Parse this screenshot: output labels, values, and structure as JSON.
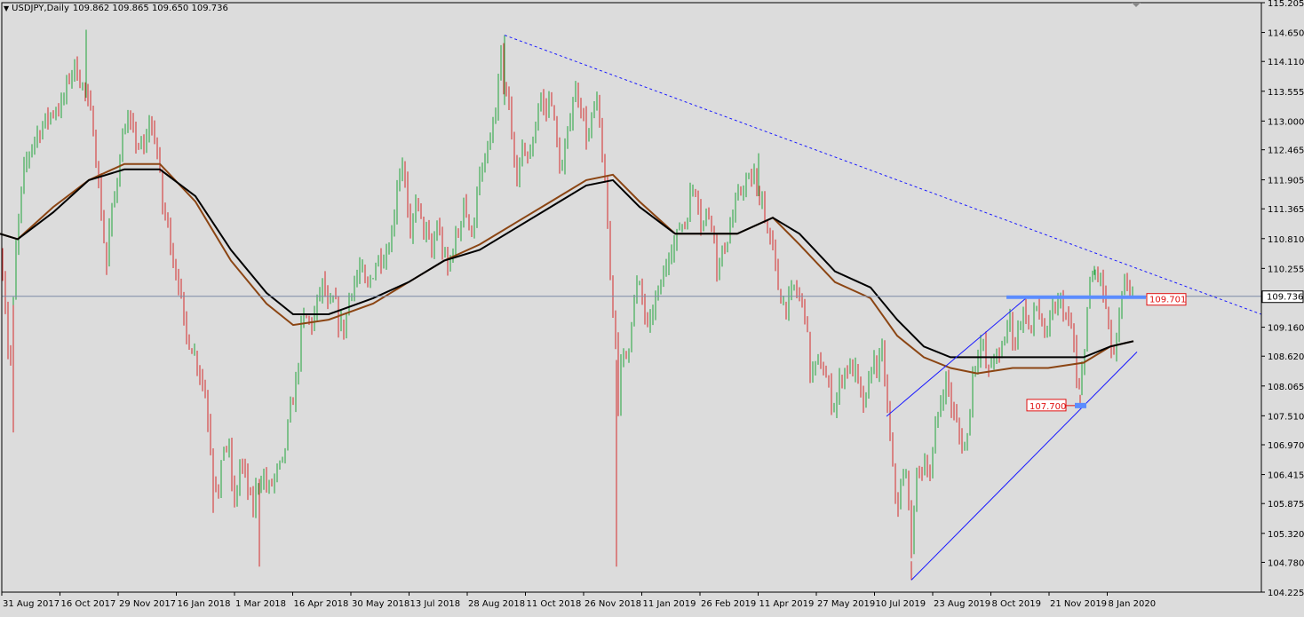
{
  "header": {
    "symbol": "USDJPY,Daily",
    "ohlc": "109.862 109.865 109.650 109.736",
    "menu_icon": "triangle-down-icon"
  },
  "colors": {
    "background": "#dcdcdc",
    "bull": "#1fa33a",
    "bear": "#d42a2a",
    "ma_fast": "#000000",
    "ma_slow": "#8b4513",
    "trendline": "#1a1aff",
    "resistance": "#5b8cff",
    "price_line": "#7c8aa6",
    "label_red": "#e01010"
  },
  "chart_data": {
    "type": "candlestick",
    "symbol": "USDJPY",
    "timeframe": "Daily",
    "ylim": [
      104.225,
      115.205
    ],
    "y_ticks": [
      "115.205",
      "114.650",
      "114.110",
      "113.555",
      "113.000",
      "112.465",
      "111.905",
      "111.365",
      "110.810",
      "110.255",
      "109.160",
      "108.620",
      "108.065",
      "107.510",
      "106.970",
      "106.415",
      "105.875",
      "105.320",
      "104.780",
      "104.225"
    ],
    "x_ticks": [
      "31 Aug 2017",
      "16 Oct 2017",
      "29 Nov 2017",
      "16 Jan 2018",
      "1 Mar 2018",
      "16 Apr 2018",
      "30 May 2018",
      "13 Jul 2018",
      "28 Aug 2018",
      "11 Oct 2018",
      "26 Nov 2018",
      "11 Jan 2019",
      "26 Feb 2019",
      "11 Apr 2019",
      "27 May 2019",
      "10 Jul 2019",
      "23 Aug 2019",
      "8 Oct 2019",
      "21 Nov 2019",
      "8 Jan 2020"
    ],
    "grid": false,
    "current_price": "109.736",
    "price_path": [
      [
        0,
        110.9
      ],
      [
        6,
        109.6
      ],
      [
        11,
        108.2
      ],
      [
        18,
        110.6
      ],
      [
        26,
        112.0
      ],
      [
        36,
        112.6
      ],
      [
        47,
        112.9
      ],
      [
        60,
        113.2
      ],
      [
        70,
        113.3
      ],
      [
        79,
        113.9
      ],
      [
        84,
        114.0
      ],
      [
        88,
        113.9
      ],
      [
        96,
        113.5
      ],
      [
        105,
        112.9
      ],
      [
        112,
        111.6
      ],
      [
        120,
        110.3
      ],
      [
        124,
        111.2
      ],
      [
        128,
        111.4
      ],
      [
        134,
        112.3
      ],
      [
        140,
        112.9
      ],
      [
        145,
        113.0
      ],
      [
        150,
        112.7
      ],
      [
        155,
        112.6
      ],
      [
        162,
        112.4
      ],
      [
        168,
        113.0
      ],
      [
        176,
        112.6
      ],
      [
        183,
        111.4
      ],
      [
        190,
        111.0
      ],
      [
        196,
        110.3
      ],
      [
        202,
        110.0
      ],
      [
        208,
        109.0
      ],
      [
        214,
        108.9
      ],
      [
        220,
        108.6
      ],
      [
        226,
        108.3
      ],
      [
        232,
        107.8
      ],
      [
        240,
        106.5
      ],
      [
        246,
        106.0
      ],
      [
        252,
        107.0
      ],
      [
        258,
        106.8
      ],
      [
        264,
        105.8
      ],
      [
        270,
        106.6
      ],
      [
        276,
        106.4
      ],
      [
        284,
        105.7
      ],
      [
        290,
        106.3
      ],
      [
        296,
        106.4
      ],
      [
        302,
        106.1
      ],
      [
        310,
        106.4
      ],
      [
        318,
        106.6
      ],
      [
        326,
        107.5
      ],
      [
        334,
        108.2
      ],
      [
        340,
        109.3
      ],
      [
        346,
        109.3
      ],
      [
        352,
        109.2
      ],
      [
        358,
        109.7
      ],
      [
        364,
        110.0
      ],
      [
        370,
        109.4
      ],
      [
        376,
        109.7
      ],
      [
        382,
        109.2
      ],
      [
        388,
        109.1
      ],
      [
        394,
        109.9
      ],
      [
        400,
        110.0
      ],
      [
        406,
        110.3
      ],
      [
        412,
        109.8
      ],
      [
        418,
        110.1
      ],
      [
        424,
        110.4
      ],
      [
        430,
        110.5
      ],
      [
        436,
        110.6
      ],
      [
        442,
        111.0
      ],
      [
        448,
        112.0
      ],
      [
        454,
        112.3
      ],
      [
        458,
        111.4
      ],
      [
        462,
        110.7
      ],
      [
        468,
        111.6
      ],
      [
        474,
        111.1
      ],
      [
        480,
        110.9
      ],
      [
        486,
        110.5
      ],
      [
        492,
        111.1
      ],
      [
        498,
        110.6
      ],
      [
        504,
        110.2
      ],
      [
        510,
        110.7
      ],
      [
        516,
        110.9
      ],
      [
        522,
        111.6
      ],
      [
        528,
        110.9
      ],
      [
        534,
        111.2
      ],
      [
        540,
        111.9
      ],
      [
        546,
        112.2
      ],
      [
        552,
        112.7
      ],
      [
        558,
        113.1
      ],
      [
        564,
        114.2
      ],
      [
        568,
        113.3
      ],
      [
        572,
        113.5
      ],
      [
        578,
        112.2
      ],
      [
        584,
        112.0
      ],
      [
        590,
        112.6
      ],
      [
        596,
        112.2
      ],
      [
        602,
        112.9
      ],
      [
        608,
        113.5
      ],
      [
        614,
        113.1
      ],
      [
        620,
        113.6
      ],
      [
        626,
        112.6
      ],
      [
        632,
        112.0
      ],
      [
        638,
        112.6
      ],
      [
        644,
        113.4
      ],
      [
        650,
        113.6
      ],
      [
        656,
        113.1
      ],
      [
        662,
        112.6
      ],
      [
        668,
        113.2
      ],
      [
        672,
        113.3
      ],
      [
        678,
        112.4
      ],
      [
        684,
        111.0
      ],
      [
        688,
        109.8
      ],
      [
        692,
        109.3
      ],
      [
        696,
        107.8
      ],
      [
        700,
        108.6
      ],
      [
        706,
        108.6
      ],
      [
        712,
        109.5
      ],
      [
        718,
        110.0
      ],
      [
        724,
        109.6
      ],
      [
        730,
        109.0
      ],
      [
        736,
        109.6
      ],
      [
        742,
        109.8
      ],
      [
        748,
        110.2
      ],
      [
        754,
        110.7
      ],
      [
        760,
        110.7
      ],
      [
        766,
        111.1
      ],
      [
        772,
        111.1
      ],
      [
        778,
        111.7
      ],
      [
        784,
        111.8
      ],
      [
        790,
        111.0
      ],
      [
        796,
        111.3
      ],
      [
        802,
        111.2
      ],
      [
        808,
        110.1
      ],
      [
        814,
        110.6
      ],
      [
        820,
        110.9
      ],
      [
        826,
        111.3
      ],
      [
        832,
        111.6
      ],
      [
        838,
        111.9
      ],
      [
        844,
        111.8
      ],
      [
        848,
        112.1
      ],
      [
        852,
        111.6
      ],
      [
        858,
        111.6
      ],
      [
        864,
        110.9
      ],
      [
        870,
        110.6
      ],
      [
        876,
        109.9
      ],
      [
        882,
        109.6
      ],
      [
        888,
        109.6
      ],
      [
        894,
        109.9
      ],
      [
        900,
        109.7
      ],
      [
        906,
        109.5
      ],
      [
        912,
        108.3
      ],
      [
        918,
        108.4
      ],
      [
        924,
        108.5
      ],
      [
        930,
        108.2
      ],
      [
        936,
        107.8
      ],
      [
        940,
        107.7
      ],
      [
        946,
        108.2
      ],
      [
        952,
        108.4
      ],
      [
        958,
        108.4
      ],
      [
        964,
        108.3
      ],
      [
        970,
        107.7
      ],
      [
        976,
        107.8
      ],
      [
        982,
        108.6
      ],
      [
        988,
        108.4
      ],
      [
        994,
        108.7
      ],
      [
        998,
        107.8
      ],
      [
        1004,
        106.6
      ],
      [
        1010,
        105.8
      ],
      [
        1016,
        106.3
      ],
      [
        1022,
        106.4
      ],
      [
        1026,
        104.8
      ],
      [
        1030,
        106.3
      ],
      [
        1036,
        106.5
      ],
      [
        1042,
        106.7
      ],
      [
        1048,
        106.4
      ],
      [
        1054,
        107.4
      ],
      [
        1060,
        107.9
      ],
      [
        1066,
        108.2
      ],
      [
        1072,
        107.6
      ],
      [
        1076,
        107.4
      ],
      [
        1082,
        107.0
      ],
      [
        1088,
        106.9
      ],
      [
        1094,
        108.2
      ],
      [
        1100,
        108.7
      ],
      [
        1106,
        108.9
      ],
      [
        1112,
        108.2
      ],
      [
        1118,
        108.7
      ],
      [
        1124,
        108.5
      ],
      [
        1130,
        108.9
      ],
      [
        1136,
        109.4
      ],
      [
        1142,
        108.8
      ],
      [
        1148,
        109.3
      ],
      [
        1154,
        109.5
      ],
      [
        1160,
        109.0
      ],
      [
        1166,
        109.6
      ],
      [
        1172,
        109.3
      ],
      [
        1178,
        108.9
      ],
      [
        1184,
        109.4
      ],
      [
        1190,
        109.6
      ],
      [
        1196,
        109.6
      ],
      [
        1202,
        109.2
      ],
      [
        1208,
        109.1
      ],
      [
        1212,
        108.0
      ],
      [
        1216,
        107.9
      ],
      [
        1220,
        108.7
      ],
      [
        1224,
        109.5
      ],
      [
        1228,
        110.0
      ],
      [
        1234,
        110.2
      ],
      [
        1240,
        110.0
      ],
      [
        1244,
        109.6
      ],
      [
        1248,
        109.1
      ],
      [
        1252,
        108.6
      ],
      [
        1256,
        108.7
      ],
      [
        1262,
        109.6
      ],
      [
        1266,
        109.9
      ],
      [
        1270,
        110.0
      ],
      [
        1276,
        109.8
      ]
    ],
    "ma_fast_path": [
      [
        0,
        110.9
      ],
      [
        20,
        110.8
      ],
      [
        60,
        111.3
      ],
      [
        100,
        111.9
      ],
      [
        140,
        112.1
      ],
      [
        180,
        112.1
      ],
      [
        220,
        111.6
      ],
      [
        260,
        110.6
      ],
      [
        300,
        109.8
      ],
      [
        330,
        109.4
      ],
      [
        370,
        109.4
      ],
      [
        420,
        109.7
      ],
      [
        460,
        110.0
      ],
      [
        500,
        110.4
      ],
      [
        540,
        110.6
      ],
      [
        580,
        111.0
      ],
      [
        620,
        111.4
      ],
      [
        660,
        111.8
      ],
      [
        690,
        111.9
      ],
      [
        720,
        111.4
      ],
      [
        760,
        110.9
      ],
      [
        800,
        110.9
      ],
      [
        830,
        110.9
      ],
      [
        870,
        111.2
      ],
      [
        900,
        110.9
      ],
      [
        940,
        110.2
      ],
      [
        980,
        109.9
      ],
      [
        1010,
        109.3
      ],
      [
        1040,
        108.8
      ],
      [
        1070,
        108.6
      ],
      [
        1100,
        108.6
      ],
      [
        1140,
        108.6
      ],
      [
        1180,
        108.6
      ],
      [
        1220,
        108.6
      ],
      [
        1250,
        108.8
      ],
      [
        1276,
        108.9
      ]
    ],
    "ma_slow_path": [
      [
        0,
        110.9
      ],
      [
        20,
        110.8
      ],
      [
        60,
        111.4
      ],
      [
        100,
        111.9
      ],
      [
        140,
        112.2
      ],
      [
        180,
        112.2
      ],
      [
        220,
        111.5
      ],
      [
        260,
        110.4
      ],
      [
        300,
        109.6
      ],
      [
        330,
        109.2
      ],
      [
        370,
        109.3
      ],
      [
        420,
        109.6
      ],
      [
        460,
        110.0
      ],
      [
        500,
        110.4
      ],
      [
        540,
        110.7
      ],
      [
        580,
        111.1
      ],
      [
        620,
        111.5
      ],
      [
        660,
        111.9
      ],
      [
        690,
        112.0
      ],
      [
        720,
        111.5
      ],
      [
        760,
        110.9
      ],
      [
        800,
        110.9
      ],
      [
        830,
        110.9
      ],
      [
        870,
        111.2
      ],
      [
        900,
        110.7
      ],
      [
        940,
        110.0
      ],
      [
        980,
        109.7
      ],
      [
        1010,
        109.0
      ],
      [
        1040,
        108.6
      ],
      [
        1070,
        108.4
      ],
      [
        1100,
        108.3
      ],
      [
        1140,
        108.4
      ],
      [
        1180,
        108.4
      ],
      [
        1220,
        108.5
      ],
      [
        1250,
        108.8
      ],
      [
        1276,
        108.9
      ]
    ],
    "annotations": {
      "downtrend": {
        "from": [
          568,
          114.6
        ],
        "to": [
          1420,
          109.4
        ]
      },
      "channel_upper": {
        "from": [
          998,
          107.5
        ],
        "to": [
          1155,
          109.7
        ]
      },
      "channel_lower": {
        "from": [
          1026,
          104.45
        ],
        "to": [
          1280,
          108.7
        ]
      },
      "resistance": {
        "from": [
          1133,
          109.72
        ],
        "to": [
          1290,
          109.72
        ],
        "label": "109.701"
      },
      "support_marker": {
        "at": [
          1216,
          107.7
        ],
        "label": "107.700"
      }
    }
  }
}
